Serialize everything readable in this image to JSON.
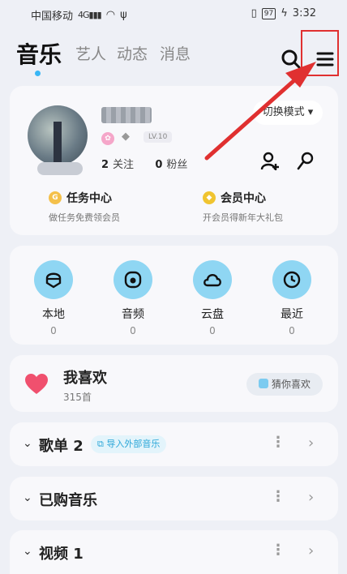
{
  "status_bar": {
    "carrier": "中国移动",
    "network": "4G",
    "battery": "97",
    "time": "3:32"
  },
  "header": {
    "tabs": [
      {
        "label": "音乐",
        "active": true
      },
      {
        "label": "艺人",
        "active": false
      },
      {
        "label": "动态",
        "active": false
      },
      {
        "label": "消息",
        "active": false
      }
    ],
    "icons": [
      "search-icon",
      "menu-icon"
    ]
  },
  "profile": {
    "level": "LV.10",
    "following_count": "2",
    "following_label": "关注",
    "fans_count": "0",
    "fans_label": "粉丝",
    "switch_mode_label": "切换模式",
    "task_center": {
      "title": "任务中心",
      "subtitle": "做任务免费领会员"
    },
    "vip_center": {
      "title": "会员中心",
      "subtitle": "开会员得新年大礼包"
    }
  },
  "quick_access": [
    {
      "label": "本地",
      "count": "0",
      "icon": "local-icon"
    },
    {
      "label": "音频",
      "count": "0",
      "icon": "audio-icon"
    },
    {
      "label": "云盘",
      "count": "0",
      "icon": "cloud-icon"
    },
    {
      "label": "最近",
      "count": "0",
      "icon": "clock-icon"
    }
  ],
  "favorites": {
    "title": "我喜欢",
    "count": "315首",
    "guess_label": "猜你喜欢"
  },
  "sections": [
    {
      "title": "歌单",
      "count": "2",
      "tag": "导入外部音乐"
    },
    {
      "title": "已购音乐",
      "count": "",
      "tag": ""
    },
    {
      "title": "视频",
      "count": "1",
      "tag": ""
    }
  ],
  "colors": {
    "accent": "#38b6f5",
    "quick_circle": "#8fd6f3",
    "heart": "#f0506e",
    "annotation": "#e03030"
  }
}
